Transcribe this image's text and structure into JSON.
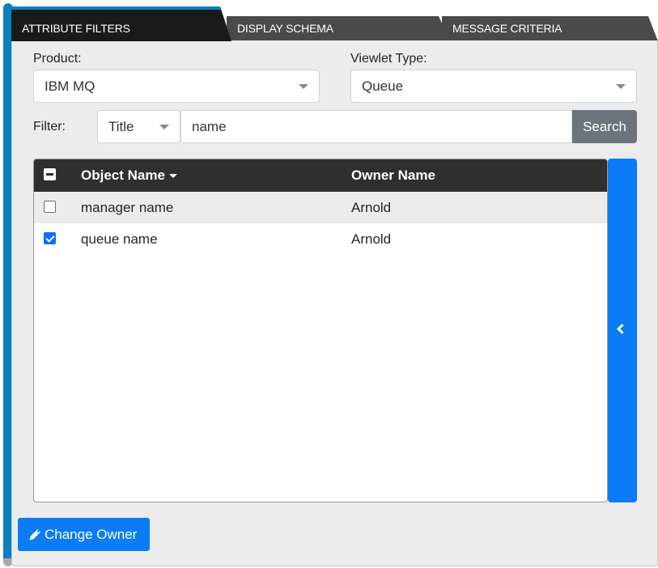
{
  "tabs": [
    {
      "label": "ATTRIBUTE FILTERS",
      "active": true
    },
    {
      "label": "DISPLAY SCHEMA",
      "active": false
    },
    {
      "label": "MESSAGE CRITERIA",
      "active": false
    }
  ],
  "product": {
    "label": "Product:",
    "value": "IBM MQ"
  },
  "viewlet_type": {
    "label": "Viewlet Type:",
    "value": "Queue"
  },
  "filter": {
    "label": "Filter:",
    "field": "Title",
    "value": "name",
    "search_label": "Search"
  },
  "table": {
    "columns": [
      "Object Name",
      "Owner Name"
    ],
    "sort_column": "Object Name",
    "sort_direction": "descending",
    "rows": [
      {
        "object_name": "manager name",
        "owner_name": "Arnold",
        "checked": false
      },
      {
        "object_name": "queue name",
        "owner_name": "Arnold",
        "checked": true
      }
    ]
  },
  "icons": {
    "side_toggle": "chevron-left-icon",
    "change_owner": "pencil-icon"
  },
  "colors": {
    "accent_blue": "#0a7cf6",
    "tab_active_underline": "#0a7fc1",
    "header_dark": "#2f2f2f",
    "search_gray": "#6c757d"
  },
  "change_owner_label": "Change Owner"
}
